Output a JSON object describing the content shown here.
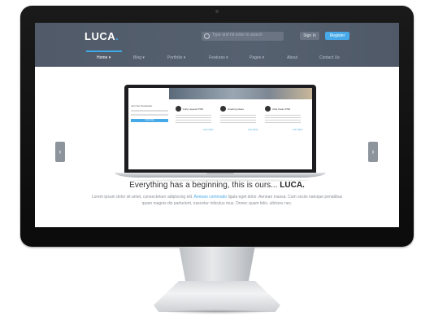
{
  "header": {
    "logo": "LUCA",
    "logo_dot": ".",
    "search_placeholder": "Type and hit enter to search",
    "signin_label": "Sign In",
    "register_label": "Register"
  },
  "nav": {
    "items": [
      {
        "label": "Home ▾"
      },
      {
        "label": "Blog ▾"
      },
      {
        "label": "Portfolio ▾"
      },
      {
        "label": "Features ▾"
      },
      {
        "label": "Pages ▾"
      },
      {
        "label": "About"
      },
      {
        "label": "Contact Us"
      }
    ]
  },
  "slider": {
    "prev_glyph": "‹",
    "next_glyph": "›",
    "laptop": {
      "newsletter_title": "Join Our Newsletter",
      "newsletter_button": "Subscribe",
      "features": [
        {
          "title": "Fully Layered PSD"
        },
        {
          "title": "Amazing Ideas"
        },
        {
          "title": "Ultra Clean PSD"
        }
      ],
      "more_label": "Learn More"
    }
  },
  "content": {
    "headline_prefix": "Everything has a beginning, this is ours... ",
    "headline_brand": "LUCA.",
    "paragraph_start": "Lorem ipsum dolor sit amet, consectetuer adipiscing elit. ",
    "paragraph_link": "Aenean commodo",
    "paragraph_end": " ligula eget dolor. Aenean massa. Cum sociis natoque penatibus quam magnis dis parturient, nascetur ridiculus mus. Donec quam felis, ultricies nec."
  },
  "colors": {
    "accent": "#47a9e8",
    "header_bg": "#545e6c"
  }
}
